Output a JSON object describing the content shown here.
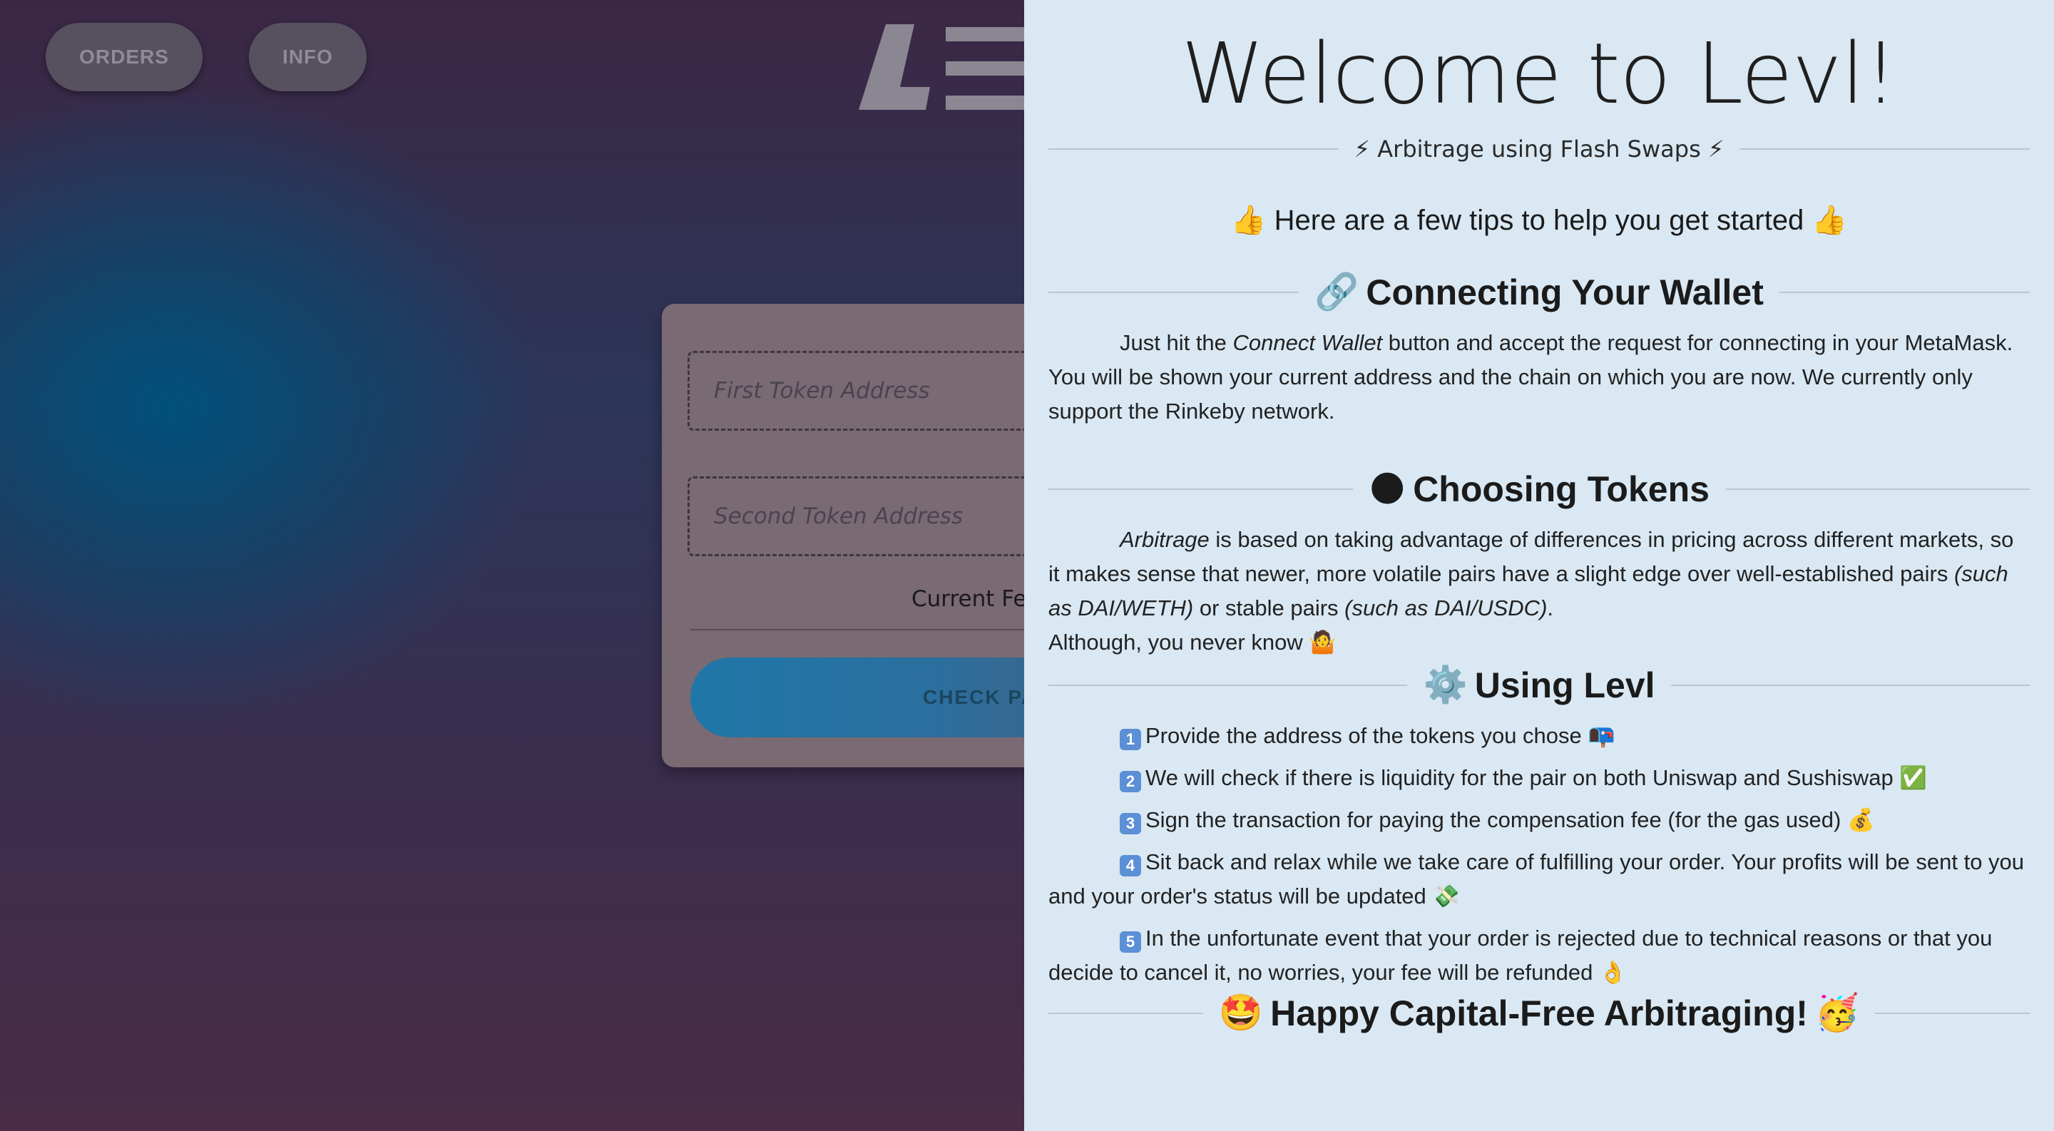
{
  "nav": {
    "orders_label": "ORDERS",
    "info_label": "INFO"
  },
  "form": {
    "first_token_placeholder": "First Token Address",
    "second_token_placeholder": "Second Token Address",
    "current_fee_label": "Current Fe",
    "check_button_label": "CHECK PA"
  },
  "drawer": {
    "title": "Welcome to Levl!",
    "subtitle": "⚡ Arbitrage using Flash Swaps ⚡",
    "tips": "👍 Here are a few tips to help you get started 👍",
    "sections": {
      "wallet": {
        "heading": "Connecting Your Wallet",
        "icon": "🔗",
        "text_before": "Just hit the ",
        "text_em": "Connect Wallet",
        "text_after": " button and accept the request for connecting in your MetaMask. You will be shown your current address and the chain on which you are now. We currently only support the Rinkeby network."
      },
      "tokens": {
        "heading": "Choosing Tokens",
        "icon": "🌑",
        "em1": "Arbitrage",
        "text1": " is based on taking advantage of differences in pricing across different markets, so it makes sense that newer, more volatile pairs have a slight edge over well-established pairs ",
        "em2": "(such as DAI/WETH)",
        "text2": " or stable pairs ",
        "em3": "(such as DAI/USDC)",
        "text3": ".",
        "line2": "Although, you never know 🤷"
      },
      "using": {
        "heading": "Using Levl",
        "icon": "⚙️",
        "steps": [
          {
            "num": "1",
            "text": "Provide the address of the tokens you chose 📭"
          },
          {
            "num": "2",
            "text": "We will check if there is liquidity for the pair on both Uniswap and Sushiswap ✅"
          },
          {
            "num": "3",
            "text": "Sign the transaction for paying the compensation fee (for the gas used) 💰"
          },
          {
            "num": "4",
            "text": "Sit back and relax while we take care of fulfilling your order. Your profits will be sent to you and your order's status will be updated 💸"
          },
          {
            "num": "5",
            "text": "In the unfortunate event that your order is rejected due to technical reasons or that you decide to cancel it, no worries, your fee will be refunded 👌"
          }
        ]
      },
      "happy": {
        "heading": "Happy Capital-Free Arbitraging!",
        "icon_left": "🤩",
        "icon_right": "🥳"
      }
    }
  },
  "colors": {
    "drawer_bg": "#d9e8f3",
    "pill_bg": "#57505f",
    "check_button": "#1f77a8"
  }
}
